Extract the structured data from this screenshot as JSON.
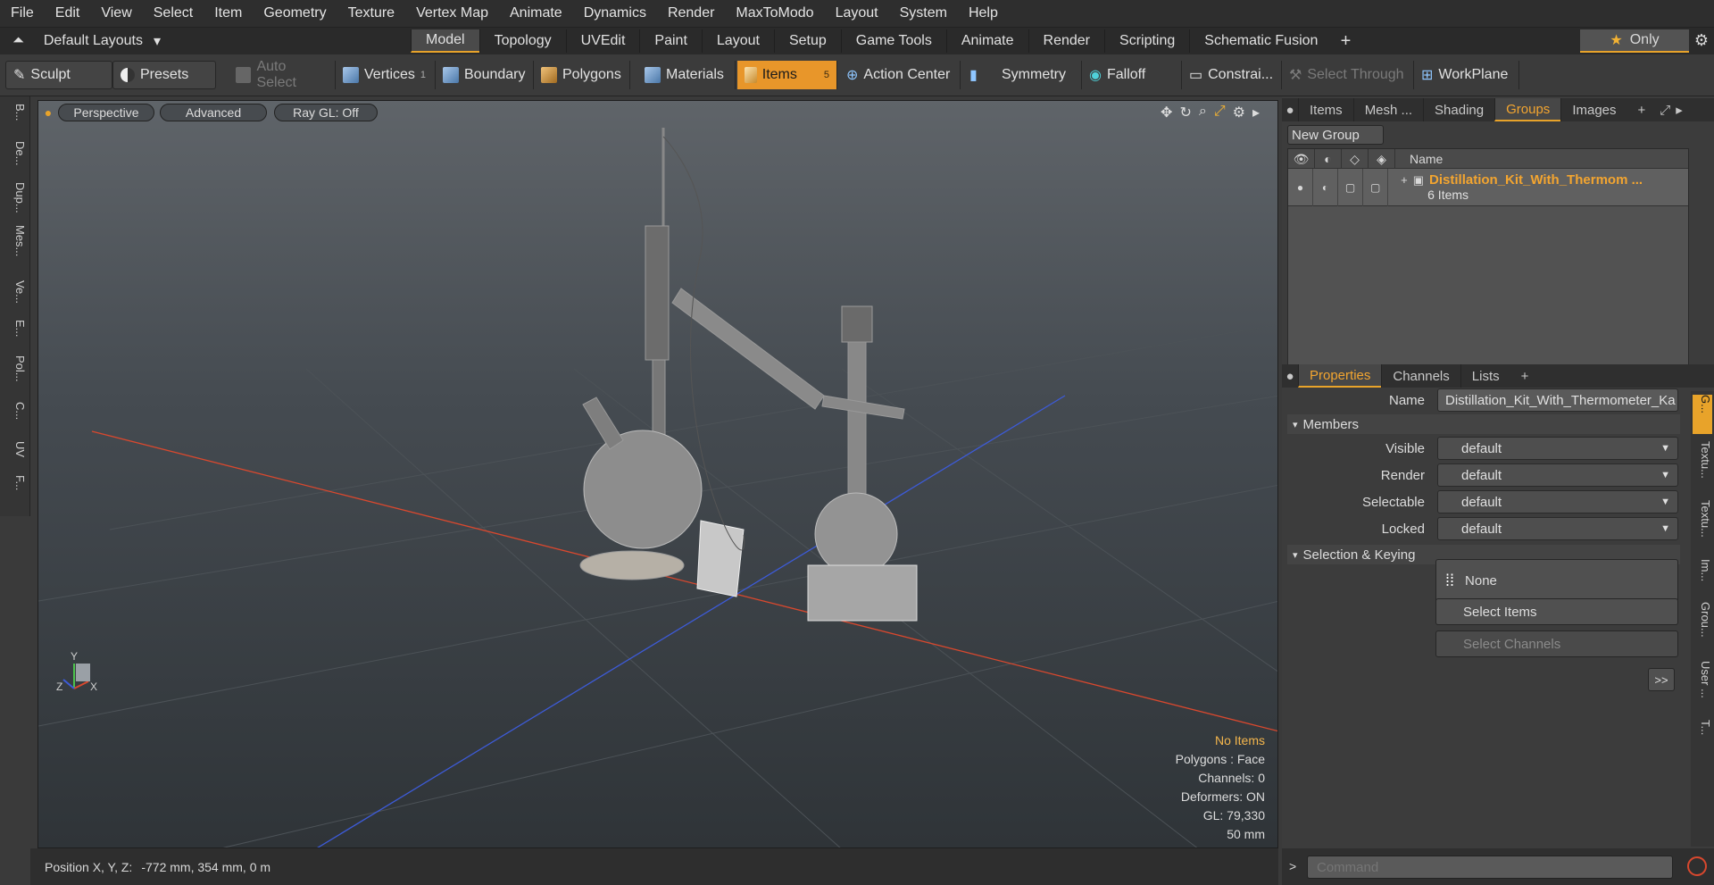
{
  "menu": [
    "File",
    "Edit",
    "View",
    "Select",
    "Item",
    "Geometry",
    "Texture",
    "Vertex Map",
    "Animate",
    "Dynamics",
    "Render",
    "MaxToModo",
    "Layout",
    "System",
    "Help"
  ],
  "layouts_label": "Default Layouts",
  "tabs": [
    "Model",
    "Topology",
    "UVEdit",
    "Paint",
    "Layout",
    "Setup",
    "Game Tools",
    "Animate",
    "Render",
    "Scripting",
    "Schematic Fusion"
  ],
  "active_tab": "Model",
  "only_label": "Only",
  "toolbar": {
    "sculpt": "Sculpt",
    "presets": "Presets",
    "auto_select": "Auto Select",
    "vertices": "Vertices",
    "vertices_count": "1",
    "boundary": "Boundary",
    "polygons": "Polygons",
    "materials": "Materials",
    "items": "Items",
    "items_count": "5",
    "action_center": "Action Center",
    "symmetry": "Symmetry",
    "falloff": "Falloff",
    "constraints": "Constrai...",
    "select_through": "Select Through",
    "workplane": "WorkPlane"
  },
  "left_tabs": [
    "B...",
    "De...",
    "Dup...",
    "Mes...",
    "Ve...",
    "E...",
    "Pol...",
    "C...",
    "UV",
    "F..."
  ],
  "viewport": {
    "perspective": "Perspective",
    "advanced": "Advanced",
    "raygl": "Ray GL: Off",
    "info": {
      "no_items": "No Items",
      "polygons": "Polygons : Face",
      "channels": "Channels: 0",
      "deformers": "Deformers: ON",
      "gl": "GL: 79,330",
      "scale": "50 mm"
    },
    "axis_x": "X",
    "axis_y": "Y",
    "axis_z": "Z"
  },
  "status": {
    "label": "Position X, Y, Z:",
    "value": "-772 mm, 354 mm, 0 m"
  },
  "top_panel": {
    "tabs": [
      "Items",
      "Mesh ...",
      "Shading",
      "Groups",
      "Images"
    ],
    "active": "Groups",
    "new_group": "New Group",
    "name_col": "Name",
    "group_name": "Distillation_Kit_With_Thermom ...",
    "group_count": "6 Items"
  },
  "props_panel": {
    "tabs": [
      "Properties",
      "Channels",
      "Lists"
    ],
    "active": "Properties",
    "name_label": "Name",
    "name_value": "Distillation_Kit_With_Thermometer_Ka",
    "members": "Members",
    "rows": [
      {
        "label": "Visible",
        "value": "default"
      },
      {
        "label": "Render",
        "value": "default"
      },
      {
        "label": "Selectable",
        "value": "default"
      },
      {
        "label": "Locked",
        "value": "default"
      }
    ],
    "selection_keying": "Selection & Keying",
    "none": "None",
    "select_items": "Select Items",
    "select_channels": "Select Channels",
    "more": ">>",
    "side_tabs": [
      "G...",
      "Textu...",
      "Textu...",
      "Im...",
      "Grou...",
      "User ...",
      "T..."
    ]
  },
  "command_placeholder": "Command",
  "colors": {
    "accent": "#e8a32a",
    "group_name": "#f3a530",
    "x_axis": "#d9482e",
    "z_axis": "#3d5bd8"
  }
}
